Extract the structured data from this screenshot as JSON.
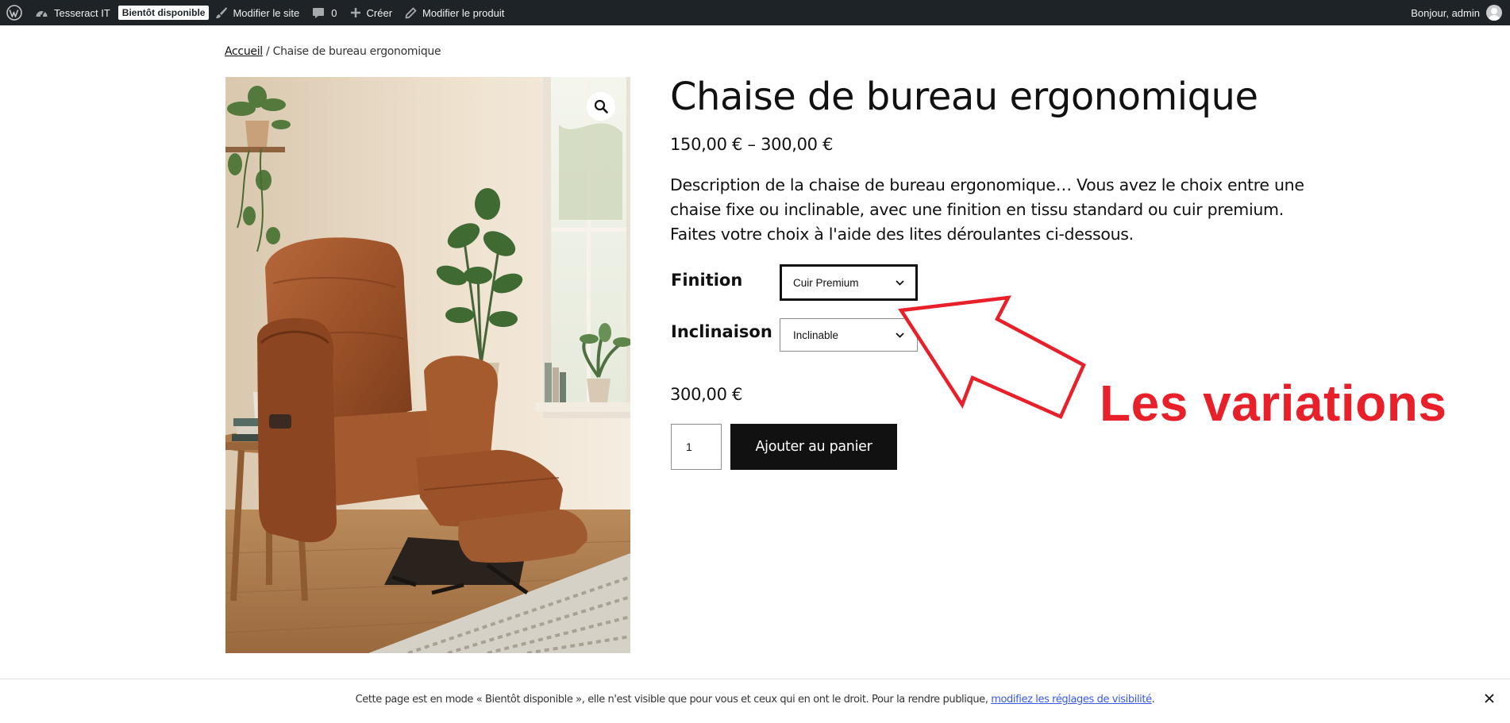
{
  "adminbar": {
    "wordpress_icon": "wordpress-logo-icon",
    "site_name": "Tesseract IT",
    "badge": "Bientôt disponible",
    "edit_site": "Modifier le site",
    "comments_count": "0",
    "create": "Créer",
    "edit_product": "Modifier le produit",
    "greeting": "Bonjour, admin"
  },
  "breadcrumb": {
    "home": "Accueil",
    "separator": " / ",
    "current": "Chaise de bureau ergonomique"
  },
  "product": {
    "title": "Chaise de bureau ergonomique",
    "price_range": "150,00 € – 300,00 €",
    "description": "Description de la chaise de bureau ergonomique… Vous avez le choix entre une chaise fixe ou inclinable, avec une finition en tissu standard ou cuir premium. Faites votre choix à l'aide des lites déroulantes ci-dessous.",
    "variations": [
      {
        "label": "Finition",
        "selected": "Cuir Premium"
      },
      {
        "label": "Inclinaison",
        "selected": "Inclinable"
      }
    ],
    "variation_price": "300,00 €",
    "quantity": "1",
    "add_to_cart": "Ajouter au panier"
  },
  "annotation": {
    "text": "Les variations",
    "color": "#e8202a"
  },
  "notice": {
    "text": "Cette page est en mode « Bientôt disponible », elle n'est visible que pour vous et ceux qui en ont le droit. Pour la rendre publique, ",
    "link": "modifiez les réglages de visibilité",
    "end": "."
  },
  "colors": {
    "adminbar_bg": "#1d2327",
    "button_bg": "#111111",
    "link_blue": "#3858e9"
  }
}
